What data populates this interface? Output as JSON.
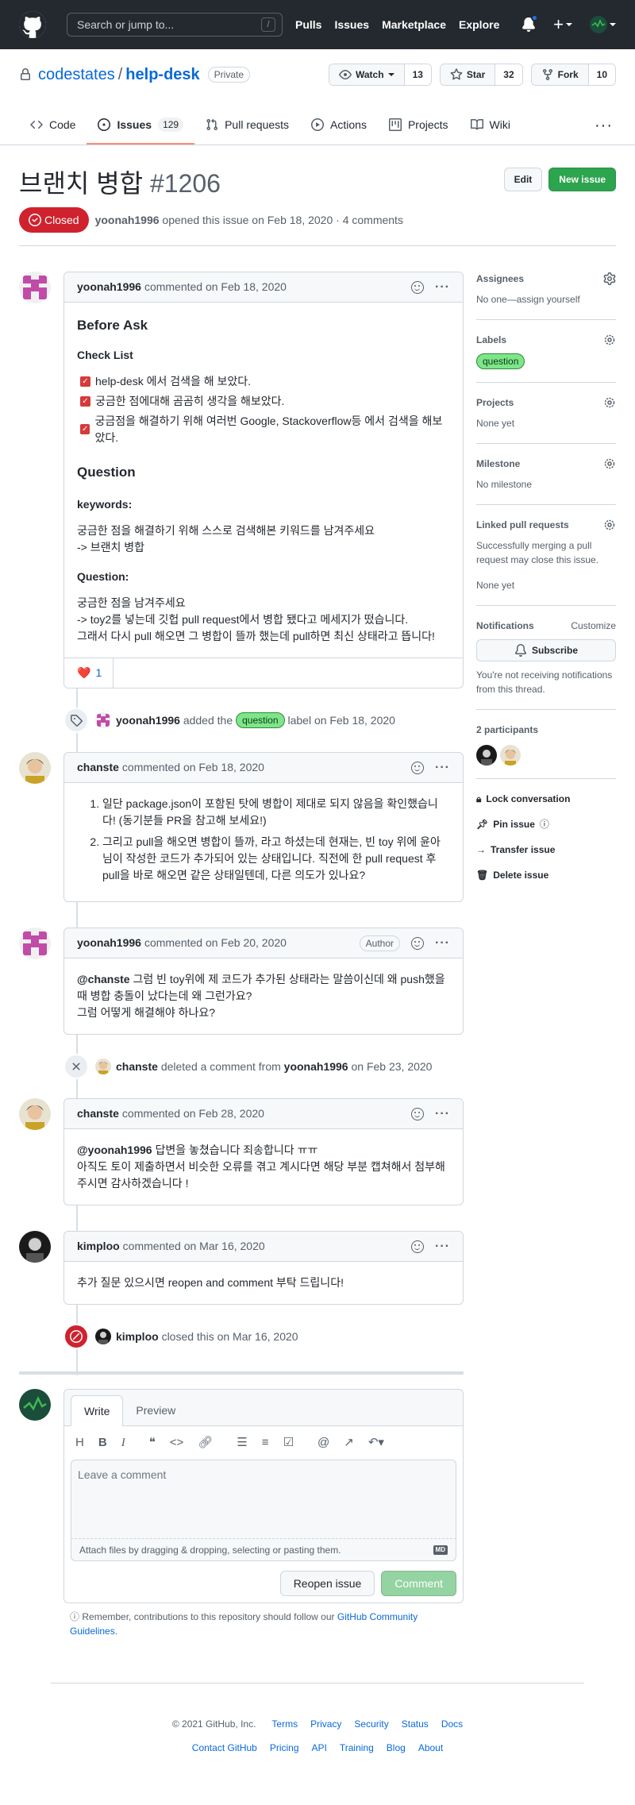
{
  "header": {
    "search_placeholder": "Search or jump to...",
    "search_key": "/",
    "nav": [
      "Pulls",
      "Issues",
      "Marketplace",
      "Explore"
    ]
  },
  "repo": {
    "owner": "codestates",
    "name": "help-desk",
    "visibility": "Private",
    "watch_label": "Watch",
    "watch_count": "13",
    "star_label": "Star",
    "star_count": "32",
    "fork_label": "Fork",
    "fork_count": "10",
    "tabs": [
      {
        "label": "Code"
      },
      {
        "label": "Issues",
        "count": "129"
      },
      {
        "label": "Pull requests"
      },
      {
        "label": "Actions"
      },
      {
        "label": "Projects"
      },
      {
        "label": "Wiki"
      }
    ]
  },
  "issue": {
    "title": "브랜치 병합",
    "number": "#1206",
    "edit_label": "Edit",
    "new_issue_label": "New issue",
    "state": "Closed",
    "author": "yoonah1996",
    "meta_text": "opened this issue on Feb 18, 2020 · 4 comments"
  },
  "comments": {
    "c1": {
      "author": "yoonah1996",
      "date": "commented on Feb 18, 2020",
      "h_before": "Before Ask",
      "h_checklist": "Check List",
      "checks": [
        "help-desk 에서 검색을 해 보았다.",
        "궁금한 점에대해 곰곰히 생각을 해보았다.",
        "궁금점을 해결하기 위해 여러번 Google, Stackoverflow등 에서 검색을 해보았다."
      ],
      "h_question": "Question",
      "h_keywords": "keywords:",
      "kw_line1": "궁금한 점을 해결하기 위해 스스로 검색해본 키워드를 남겨주세요",
      "kw_line2": "-> 브랜치 병합",
      "h_question2": "Question:",
      "q_line1": "궁금한 점을 남겨주세요",
      "q_line2": "-> toy2를 넣는데 깃헙 pull request에서 병합 됐다고 메세지가 떴습니다.",
      "q_line3": "그래서 다시 pull 해오면 그 병합이 뜰까 했는데 pull하면 최신 상태라고 뜹니다!",
      "reaction_emoji": "❤️",
      "reaction_count": "1"
    },
    "e1": {
      "author": "yoonah1996",
      "text_a": "added the",
      "label": "question",
      "text_b": "label on Feb 18, 2020"
    },
    "c2": {
      "author": "chanste",
      "date": "commented on Feb 18, 2020",
      "items": [
        "일단 package.json이 포함된 탓에 병합이 제대로 되지 않음을 확인했습니다! (동기분들 PR을 참고해 보세요!)",
        "그리고 pull을 해오면 병합이 뜰까, 라고 하셨는데 현재는, 빈 toy 위에 윤아님이 작성한 코드가 추가되어 있는 상태입니다. 직전에 한 pull request 후 pull을 바로 해오면 같은 상태일텐데, 다른 의도가 있나요?"
      ]
    },
    "c3": {
      "author": "yoonah1996",
      "date": "commented on Feb 20, 2020",
      "badge": "Author",
      "mention": "@chanste",
      "line1": " 그럼 빈 toy위에 제 코드가 추가된 상태라는 말씀이신데 왜 push했을때 병합 충돌이 났다는데 왜 그런가요?",
      "line2": "그럼 어떻게 해결해야 하나요?"
    },
    "e2": {
      "actor": "chanste",
      "text": "deleted a comment from",
      "target": "yoonah1996",
      "date": "on Feb 23, 2020"
    },
    "c4": {
      "author": "chanste",
      "date": "commented on Feb 28, 2020",
      "mention": "@yoonah1996",
      "line1": " 답변을 놓쳤습니다 죄송합니다 ㅠㅠ",
      "line2": "아직도 토이 제출하면서 비슷한 오류를 겪고 계시다면 해당 부분 캡쳐해서 첨부해 주시면 감사하겠습니다 !"
    },
    "c5": {
      "author": "kimploo",
      "date": "commented on Mar 16, 2020",
      "text": "추가 질문 있으시면 reopen and comment 부탁 드립니다!"
    },
    "e3": {
      "actor": "kimploo",
      "text": "closed this on Mar 16, 2020"
    }
  },
  "editor": {
    "tab_write": "Write",
    "tab_preview": "Preview",
    "placeholder": "Leave a comment",
    "attach_text": "Attach files by dragging & dropping, selecting or pasting them.",
    "md_badge": "MD",
    "reopen_label": "Reopen issue",
    "comment_label": "Comment",
    "remember_text": "Remember, contributions to this repository should follow our",
    "remember_link": "GitHub Community Guidelines",
    "remember_end": "."
  },
  "sidebar": {
    "assignees_title": "Assignees",
    "assignees_value": "No one—assign yourself",
    "labels_title": "Labels",
    "labels_value": "question",
    "projects_title": "Projects",
    "projects_value": "None yet",
    "milestone_title": "Milestone",
    "milestone_value": "No milestone",
    "linked_title": "Linked pull requests",
    "linked_desc": "Successfully merging a pull request may close this issue.",
    "linked_value": "None yet",
    "notif_title": "Notifications",
    "notif_customize": "Customize",
    "subscribe_label": "Subscribe",
    "notif_desc": "You're not receiving notifications from this thread.",
    "participants_title": "2 participants",
    "lock": "Lock conversation",
    "pin": "Pin issue",
    "transfer": "Transfer issue",
    "delete": "Delete issue"
  },
  "footer": {
    "copyright": "© 2021 GitHub, Inc.",
    "row1": [
      "Terms",
      "Privacy",
      "Security",
      "Status",
      "Docs"
    ],
    "row2": [
      "Contact GitHub",
      "Pricing",
      "API",
      "Training",
      "Blog",
      "About"
    ]
  },
  "colors": {
    "header_bg": "#24292f",
    "closed_red": "#cf222e",
    "green": "#2da44e",
    "link_blue": "#0969da",
    "label_green": "#7ee58a"
  }
}
